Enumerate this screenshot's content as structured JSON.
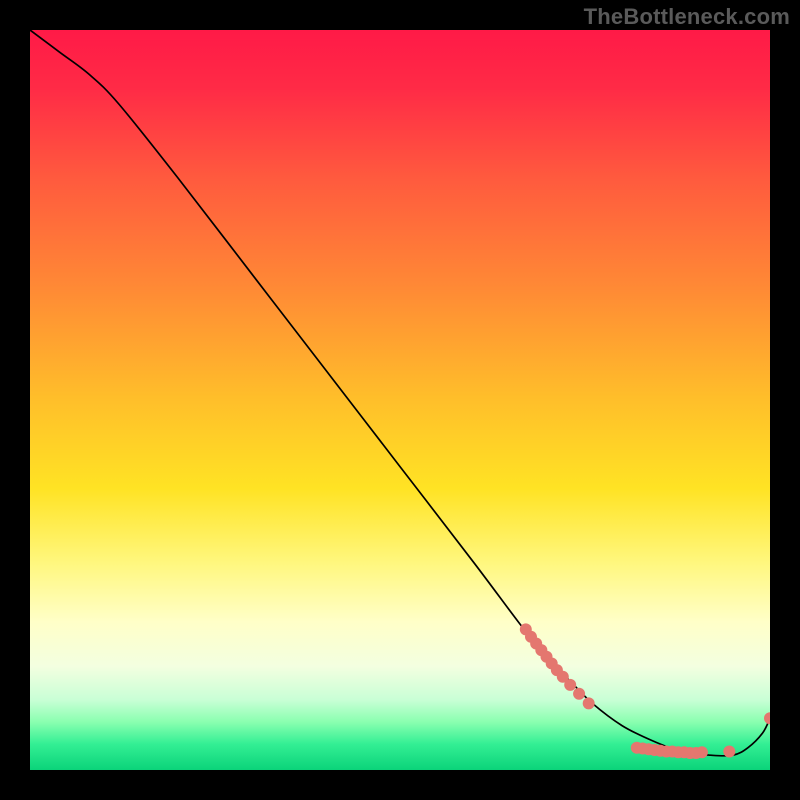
{
  "watermark": "TheBottleneck.com",
  "chart_data": {
    "type": "line",
    "title": "",
    "xlabel": "",
    "ylabel": "",
    "xlim": [
      0,
      100
    ],
    "ylim": [
      0,
      100
    ],
    "background_gradient": {
      "stops": [
        {
          "offset": 0.0,
          "color": "#ff1a47"
        },
        {
          "offset": 0.08,
          "color": "#ff2b46"
        },
        {
          "offset": 0.2,
          "color": "#ff5a3e"
        },
        {
          "offset": 0.35,
          "color": "#ff8a35"
        },
        {
          "offset": 0.5,
          "color": "#ffbf2a"
        },
        {
          "offset": 0.62,
          "color": "#ffe324"
        },
        {
          "offset": 0.72,
          "color": "#fff77e"
        },
        {
          "offset": 0.8,
          "color": "#ffffc8"
        },
        {
          "offset": 0.86,
          "color": "#f3ffe0"
        },
        {
          "offset": 0.905,
          "color": "#c9ffd6"
        },
        {
          "offset": 0.935,
          "color": "#8affb0"
        },
        {
          "offset": 0.965,
          "color": "#33ef94"
        },
        {
          "offset": 1.0,
          "color": "#0bd37a"
        }
      ]
    },
    "series": [
      {
        "name": "bottleneck-curve",
        "type": "line",
        "color": "#000000",
        "x": [
          0,
          4,
          8,
          12,
          20,
          30,
          40,
          50,
          60,
          66,
          70,
          73,
          76,
          80,
          84,
          88,
          92,
          95,
          97,
          99,
          100
        ],
        "y": [
          100,
          97,
          94,
          90,
          80,
          67,
          54,
          41,
          28,
          20,
          15,
          12,
          9,
          6,
          4,
          2.5,
          2,
          2,
          3,
          5,
          7
        ]
      },
      {
        "name": "gpu-marks",
        "type": "scatter",
        "color": "#e4776f",
        "radius": 6,
        "points": [
          {
            "x": 67.0,
            "y": 19.0
          },
          {
            "x": 67.7,
            "y": 18.0
          },
          {
            "x": 68.4,
            "y": 17.1
          },
          {
            "x": 69.1,
            "y": 16.2
          },
          {
            "x": 69.8,
            "y": 15.3
          },
          {
            "x": 70.5,
            "y": 14.4
          },
          {
            "x": 71.2,
            "y": 13.5
          },
          {
            "x": 72.0,
            "y": 12.6
          },
          {
            "x": 73.0,
            "y": 11.5
          },
          {
            "x": 74.2,
            "y": 10.3
          },
          {
            "x": 75.5,
            "y": 9.0
          },
          {
            "x": 82.0,
            "y": 3.0
          },
          {
            "x": 82.8,
            "y": 2.9
          },
          {
            "x": 83.6,
            "y": 2.8
          },
          {
            "x": 84.4,
            "y": 2.7
          },
          {
            "x": 85.2,
            "y": 2.6
          },
          {
            "x": 86.0,
            "y": 2.5
          },
          {
            "x": 86.8,
            "y": 2.5
          },
          {
            "x": 87.6,
            "y": 2.4
          },
          {
            "x": 88.4,
            "y": 2.4
          },
          {
            "x": 89.2,
            "y": 2.3
          },
          {
            "x": 90.0,
            "y": 2.3
          },
          {
            "x": 90.8,
            "y": 2.4
          },
          {
            "x": 94.5,
            "y": 2.5
          },
          {
            "x": 100.0,
            "y": 7.0
          }
        ]
      }
    ]
  }
}
